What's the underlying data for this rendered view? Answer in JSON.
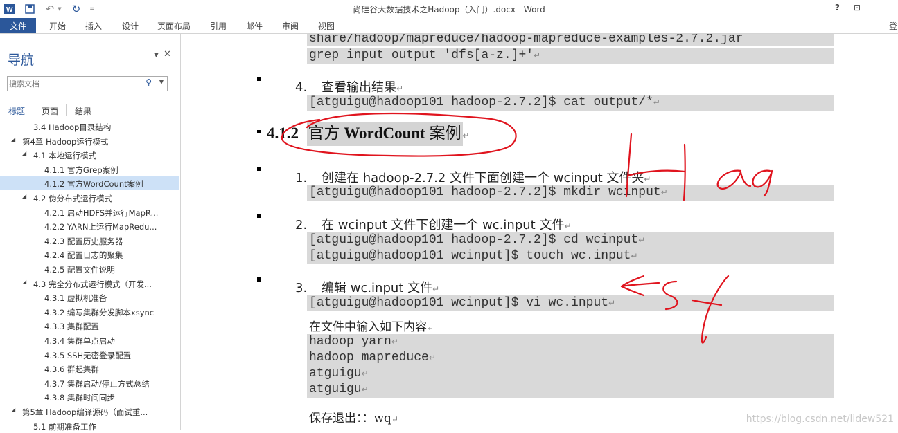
{
  "window": {
    "title": "尚硅谷大数据技术之Hadoop（入门）.docx - Word",
    "help": "?",
    "ribbon_toggle": "⊡",
    "minimize": "—"
  },
  "ribbon": {
    "file": "文件",
    "tabs": [
      "开始",
      "插入",
      "设计",
      "页面布局",
      "引用",
      "邮件",
      "审阅",
      "视图"
    ],
    "sign_in": "登"
  },
  "nav": {
    "title": "导航",
    "search_placeholder": "搜索文档",
    "tabs": [
      "标题",
      "页面",
      "结果"
    ],
    "items": [
      {
        "label": "3.4 Hadoop目录结构",
        "level": 2,
        "expanded": false
      },
      {
        "label": "第4章 Hadoop运行模式",
        "level": 1,
        "expanded": true
      },
      {
        "label": "4.1 本地运行模式",
        "level": 2,
        "expanded": true
      },
      {
        "label": "4.1.1 官方Grep案例",
        "level": 3
      },
      {
        "label": "4.1.2 官方WordCount案例",
        "level": 3,
        "selected": true
      },
      {
        "label": "4.2 伪分布式运行模式",
        "level": 2,
        "expanded": true
      },
      {
        "label": "4.2.1 启动HDFS并运行MapR...",
        "level": 3
      },
      {
        "label": "4.2.2 YARN上运行MapRedu...",
        "level": 3
      },
      {
        "label": "4.2.3 配置历史服务器",
        "level": 3
      },
      {
        "label": "4.2.4 配置日志的聚集",
        "level": 3
      },
      {
        "label": "4.2.5 配置文件说明",
        "level": 3
      },
      {
        "label": "4.3 完全分布式运行模式（开发...",
        "level": 2,
        "expanded": true
      },
      {
        "label": "4.3.1 虚拟机准备",
        "level": 3
      },
      {
        "label": "4.3.2 编写集群分发脚本xsync",
        "level": 3
      },
      {
        "label": "4.3.3 集群配置",
        "level": 3
      },
      {
        "label": "4.3.4 集群单点启动",
        "level": 3
      },
      {
        "label": "4.3.5 SSH无密登录配置",
        "level": 3
      },
      {
        "label": "4.3.6 群起集群",
        "level": 3
      },
      {
        "label": "4.3.7 集群启动/停止方式总结",
        "level": 3
      },
      {
        "label": "4.3.8 集群时间同步",
        "level": 3
      },
      {
        "label": "第5章 Hadoop编译源码（面试重...",
        "level": 1,
        "expanded": true
      },
      {
        "label": "5.1 前期准备工作",
        "level": 2
      }
    ]
  },
  "doc": {
    "code_top_1": "share/hadoop/mapreduce/hadoop-mapreduce-examples-2.7.2.jar",
    "code_top_2": "grep input output 'dfs[a-z.]+'",
    "step4": {
      "num": "4.",
      "text": "查看输出结果"
    },
    "code_step4": "[atguigu@hadoop101 hadoop-2.7.2]$ cat output/*",
    "heading": {
      "num": "4.1.2",
      "pre": "官方",
      "bold": "WordCount",
      "post": "案例"
    },
    "step1": {
      "num": "1.",
      "text": "创建在 hadoop-2.7.2 文件下面创建一个 wcinput 文件夹"
    },
    "code_step1": "[atguigu@hadoop101 hadoop-2.7.2]$ mkdir wcinput",
    "step2": {
      "num": "2.",
      "text": "在 wcinput 文件下创建一个 wc.input 文件"
    },
    "code_step2a": "[atguigu@hadoop101 hadoop-2.7.2]$ cd wcinput",
    "code_step2b": "[atguigu@hadoop101 wcinput]$ touch wc.input",
    "step3": {
      "num": "3.",
      "text": "编辑 wc.input 文件"
    },
    "code_step3": "[atguigu@hadoop101 wcinput]$ vi wc.input",
    "note_input": "在文件中输入如下内容",
    "content_lines": [
      "hadoop yarn",
      "hadoop mapreduce",
      "atguigu",
      "atguigu"
    ],
    "note_save": "保存退出：：wq",
    "paragraph_mark": "↵"
  },
  "watermark": "https://blog.csdn.net/lidew521",
  "colors": {
    "accent": "#2b579a",
    "ink": "#e0141e",
    "code_bg": "#d9d9d9",
    "selected": "#cde1f7"
  }
}
